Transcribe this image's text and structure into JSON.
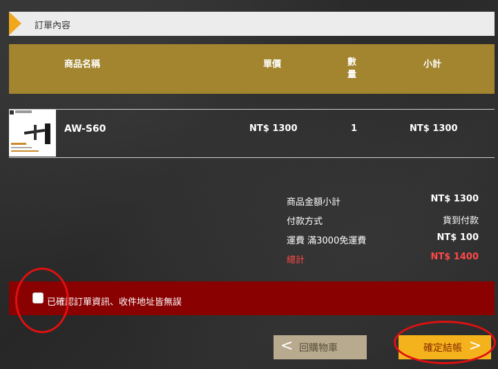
{
  "section": {
    "title": "訂單內容"
  },
  "table": {
    "headers": {
      "name": "商品名稱",
      "price": "單價",
      "qty": "數量",
      "subtotal": "小計"
    },
    "items": [
      {
        "name": "AW-S60",
        "price": "NT$ 1300",
        "qty": "1",
        "subtotal": "NT$ 1300"
      }
    ]
  },
  "summary": {
    "rows": [
      {
        "label": "商品金額小計",
        "value": "NT$ 1300"
      },
      {
        "label": "付款方式",
        "value": "貨到付款"
      },
      {
        "label": "運費 滿3000免運費",
        "value": "NT$ 100"
      },
      {
        "label": "總計",
        "value": "NT$ 1400"
      }
    ]
  },
  "confirm": {
    "label": "已確認訂單資訊、收件地址皆無誤",
    "checked": false
  },
  "buttons": {
    "back": "回購物車",
    "next": "確定結帳"
  },
  "colors": {
    "accent": "#f2a81d",
    "table_header": "#a3852f",
    "confirm_bar": "#8a0101",
    "total_red": "#ff4848",
    "annotation": "#e01010"
  }
}
